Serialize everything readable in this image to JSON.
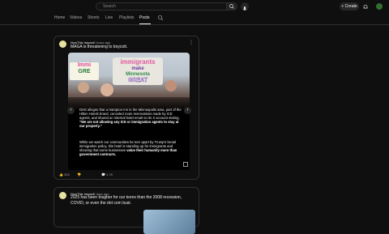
{
  "search": {
    "placeholder": "Search"
  },
  "header": {
    "create_label": "+ Create"
  },
  "tabs": [
    {
      "label": "Home"
    },
    {
      "label": "Videos"
    },
    {
      "label": "Shorts"
    },
    {
      "label": "Live"
    },
    {
      "label": "Playlists"
    },
    {
      "label": "Posts"
    }
  ],
  "post1": {
    "channel": "NowThis Impact",
    "time": "4 hours ago",
    "text": "MAGA is threatening to boycott.",
    "image": {
      "sign_lines": [
        "immigrants",
        "make",
        "Minnesota",
        "GREAT"
      ],
      "sign_small_lines": [
        "Immi",
        "GRE"
      ]
    },
    "overlay_para1_plain": "DHS alleges that a Hampton Inn in the Minneapolis area, part of the Hilton Hotels brand, canceled room reservations made by ICE agents, and shared an internal hotel email on its X account stating, ",
    "overlay_para1_bold": "\"We are not allowing any ICE or immigration agents to stay at our property.\"",
    "overlay_para2_plain": "While we watch our communities be torn apart by Trump's brutal immigration policy, this hotel is standing up for immigrants and showing that some businesses ",
    "overlay_para2_bold": "value their humanity more than government contracts.",
    "likes": "324",
    "comments": "1.7K"
  },
  "post2": {
    "channel": "NowThis Impact",
    "time": "3 days ago",
    "text": "2025 has been tougher for our teens than the 2008 recession, COVID, or even the dot com bust."
  },
  "colors": {
    "background": "#0f0f0f",
    "text": "#f1f1f1",
    "muted": "#aaaaaa",
    "border": "#303030"
  }
}
